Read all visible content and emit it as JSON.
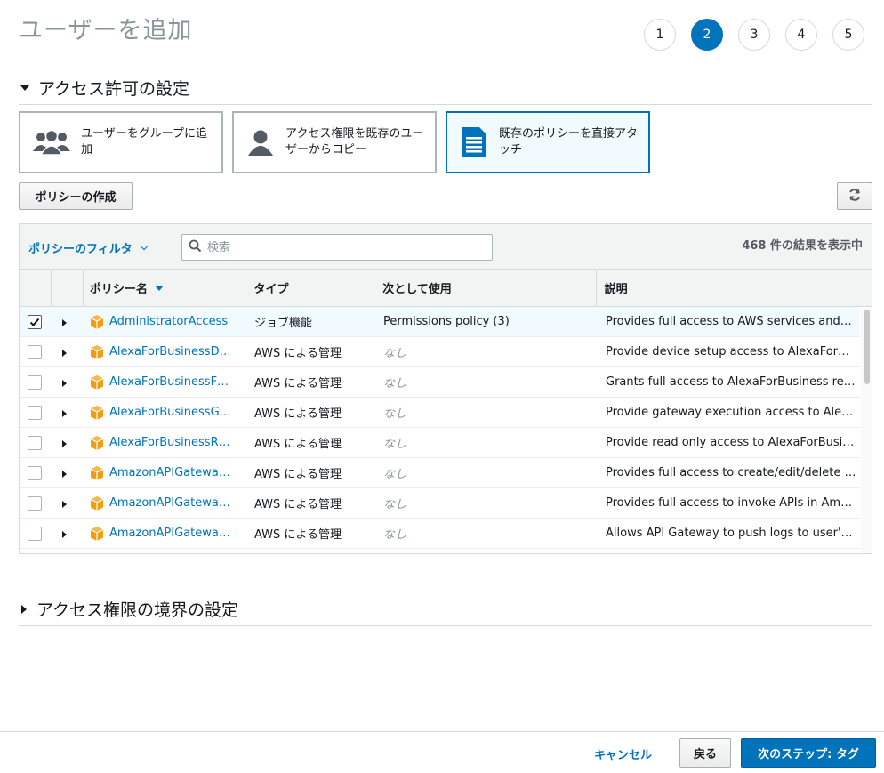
{
  "page": {
    "title": "ユーザーを追加"
  },
  "steps": [
    "1",
    "2",
    "3",
    "4",
    "5"
  ],
  "active_step": "2",
  "permissions_section": {
    "title": "アクセス許可の設定"
  },
  "options": [
    {
      "label": "ユーザーをグループに追加",
      "icon": "user-group-icon",
      "selected": false
    },
    {
      "label": "アクセス権限を既存のユーザーからコピー",
      "icon": "user-icon",
      "selected": false
    },
    {
      "label": "既存のポリシーを直接アタッチ",
      "icon": "document-icon",
      "selected": true
    }
  ],
  "toolbar": {
    "create_policy": "ポリシーの作成",
    "refresh_icon": "refresh-icon"
  },
  "filter": {
    "label": "ポリシーのフィルタ",
    "search_placeholder": "検索",
    "result_count": "468 件の結果を表示中"
  },
  "table": {
    "headers": {
      "name": "ポリシー名",
      "type": "タイプ",
      "used_as": "次として使用",
      "description": "説明"
    },
    "rows": [
      {
        "checked": true,
        "name": "AdministratorAccess",
        "type": "ジョブ機能",
        "used_as": "Permissions policy (3)",
        "description": "Provides full access to AWS services and…"
      },
      {
        "checked": false,
        "name": "AlexaForBusinessD…",
        "type": "AWS による管理",
        "used_as": "なし",
        "description": "Provide device setup access to AlexaFor…"
      },
      {
        "checked": false,
        "name": "AlexaForBusinessF…",
        "type": "AWS による管理",
        "used_as": "なし",
        "description": "Grants full access to AlexaForBusiness re…"
      },
      {
        "checked": false,
        "name": "AlexaForBusinessG…",
        "type": "AWS による管理",
        "used_as": "なし",
        "description": "Provide gateway execution access to Ale…"
      },
      {
        "checked": false,
        "name": "AlexaForBusinessR…",
        "type": "AWS による管理",
        "used_as": "なし",
        "description": "Provide read only access to AlexaForBusi…"
      },
      {
        "checked": false,
        "name": "AmazonAPIGatewa…",
        "type": "AWS による管理",
        "used_as": "なし",
        "description": "Provides full access to create/edit/delete …"
      },
      {
        "checked": false,
        "name": "AmazonAPIGatewa…",
        "type": "AWS による管理",
        "used_as": "なし",
        "description": "Provides full access to invoke APIs in Am…"
      },
      {
        "checked": false,
        "name": "AmazonAPIGatewa…",
        "type": "AWS による管理",
        "used_as": "なし",
        "description": "Allows API Gateway to push logs to user'…"
      }
    ]
  },
  "boundary_section": {
    "title": "アクセス権限の境界の設定"
  },
  "footer": {
    "cancel": "キャンセル",
    "back": "戻る",
    "next": "次のステップ: タグ"
  },
  "colors": {
    "accent": "#0073bb",
    "policy_icon": "#f29c0f",
    "selected_bg": "#f1faff"
  }
}
